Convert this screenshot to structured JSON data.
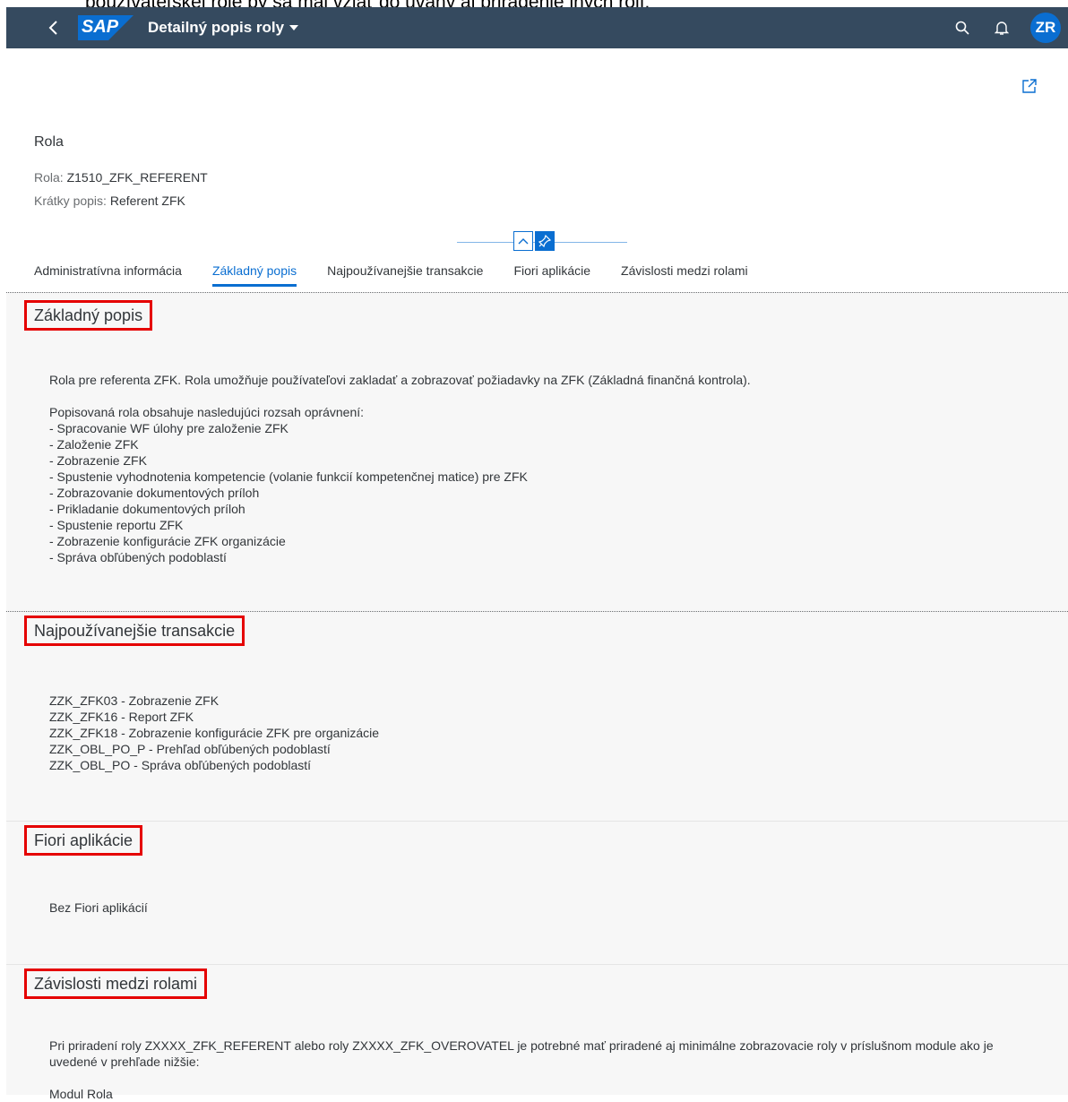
{
  "doc_overlay_text": "používateľskej role by sa mal vziať do úvahy aj priradenie iných rolí.",
  "shellbar": {
    "logo_text": "SAP",
    "app_title": "Detailný popis roly",
    "avatar_initials": "ZR",
    "colors": {
      "background": "#354a5f",
      "avatar": "#0a6ed1",
      "logo": "#0a6ed1"
    }
  },
  "header": {
    "title": "Rola",
    "role_label": "Rola:",
    "role_value": "Z1510_ZFK_REFERENT",
    "short_desc_label": "Krátky popis:",
    "short_desc_value": "Referent ZFK"
  },
  "tabs": [
    {
      "label": "Administratívna informácia",
      "active": false
    },
    {
      "label": "Základný popis",
      "active": true
    },
    {
      "label": "Najpoužívanejšie transakcie",
      "active": false
    },
    {
      "label": "Fiori aplikácie",
      "active": false
    },
    {
      "label": "Závislosti medzi rolami",
      "active": false
    }
  ],
  "sections": {
    "basic": {
      "title": "Základný popis",
      "body": "Rola pre referenta ZFK. Rola umožňuje používateľovi zakladať a zobrazovať požiadavky na ZFK (Základná finančná kontrola).\n\nPopisovaná rola obsahuje nasledujúci rozsah oprávnení:\n- Spracovanie WF úlohy pre založenie ZFK\n- Založenie ZFK\n- Zobrazenie ZFK\n- Spustenie vyhodnotenia kompetencie (volanie funkcií kompetenčnej matice) pre ZFK\n- Zobrazovanie dokumentových príloh\n- Prikladanie dokumentových príloh\n- Spustenie reportu ZFK\n- Zobrazenie konfigurácie ZFK organizácie\n- Správa obľúbených podoblastí"
    },
    "transactions": {
      "title": "Najpoužívanejšie transakcie",
      "body": "ZZK_ZFK03 - Zobrazenie ZFK\nZZK_ZFK16 - Report ZFK\nZZK_ZFK18 - Zobrazenie konfigurácie ZFK pre organizácie\nZZK_OBL_PO_P - Prehľad obľúbených podoblastí\nZZK_OBL_PO - Správa obľúbených podoblastí"
    },
    "fiori": {
      "title": "Fiori aplikácie",
      "body": "Bez Fiori aplikácií"
    },
    "dependencies": {
      "title": "Závislosti medzi rolami",
      "body": "Pri priradení roly ZXXXX_ZFK_REFERENT alebo roly ZXXXX_ZFK_OVEROVATEL je potrebné mať priradené aj minimálne zobrazovacie roly v príslušnom module ako je\nuvedené v prehľade nižšie:\n\nModul Rola"
    }
  },
  "highlight_color": "#e50000"
}
